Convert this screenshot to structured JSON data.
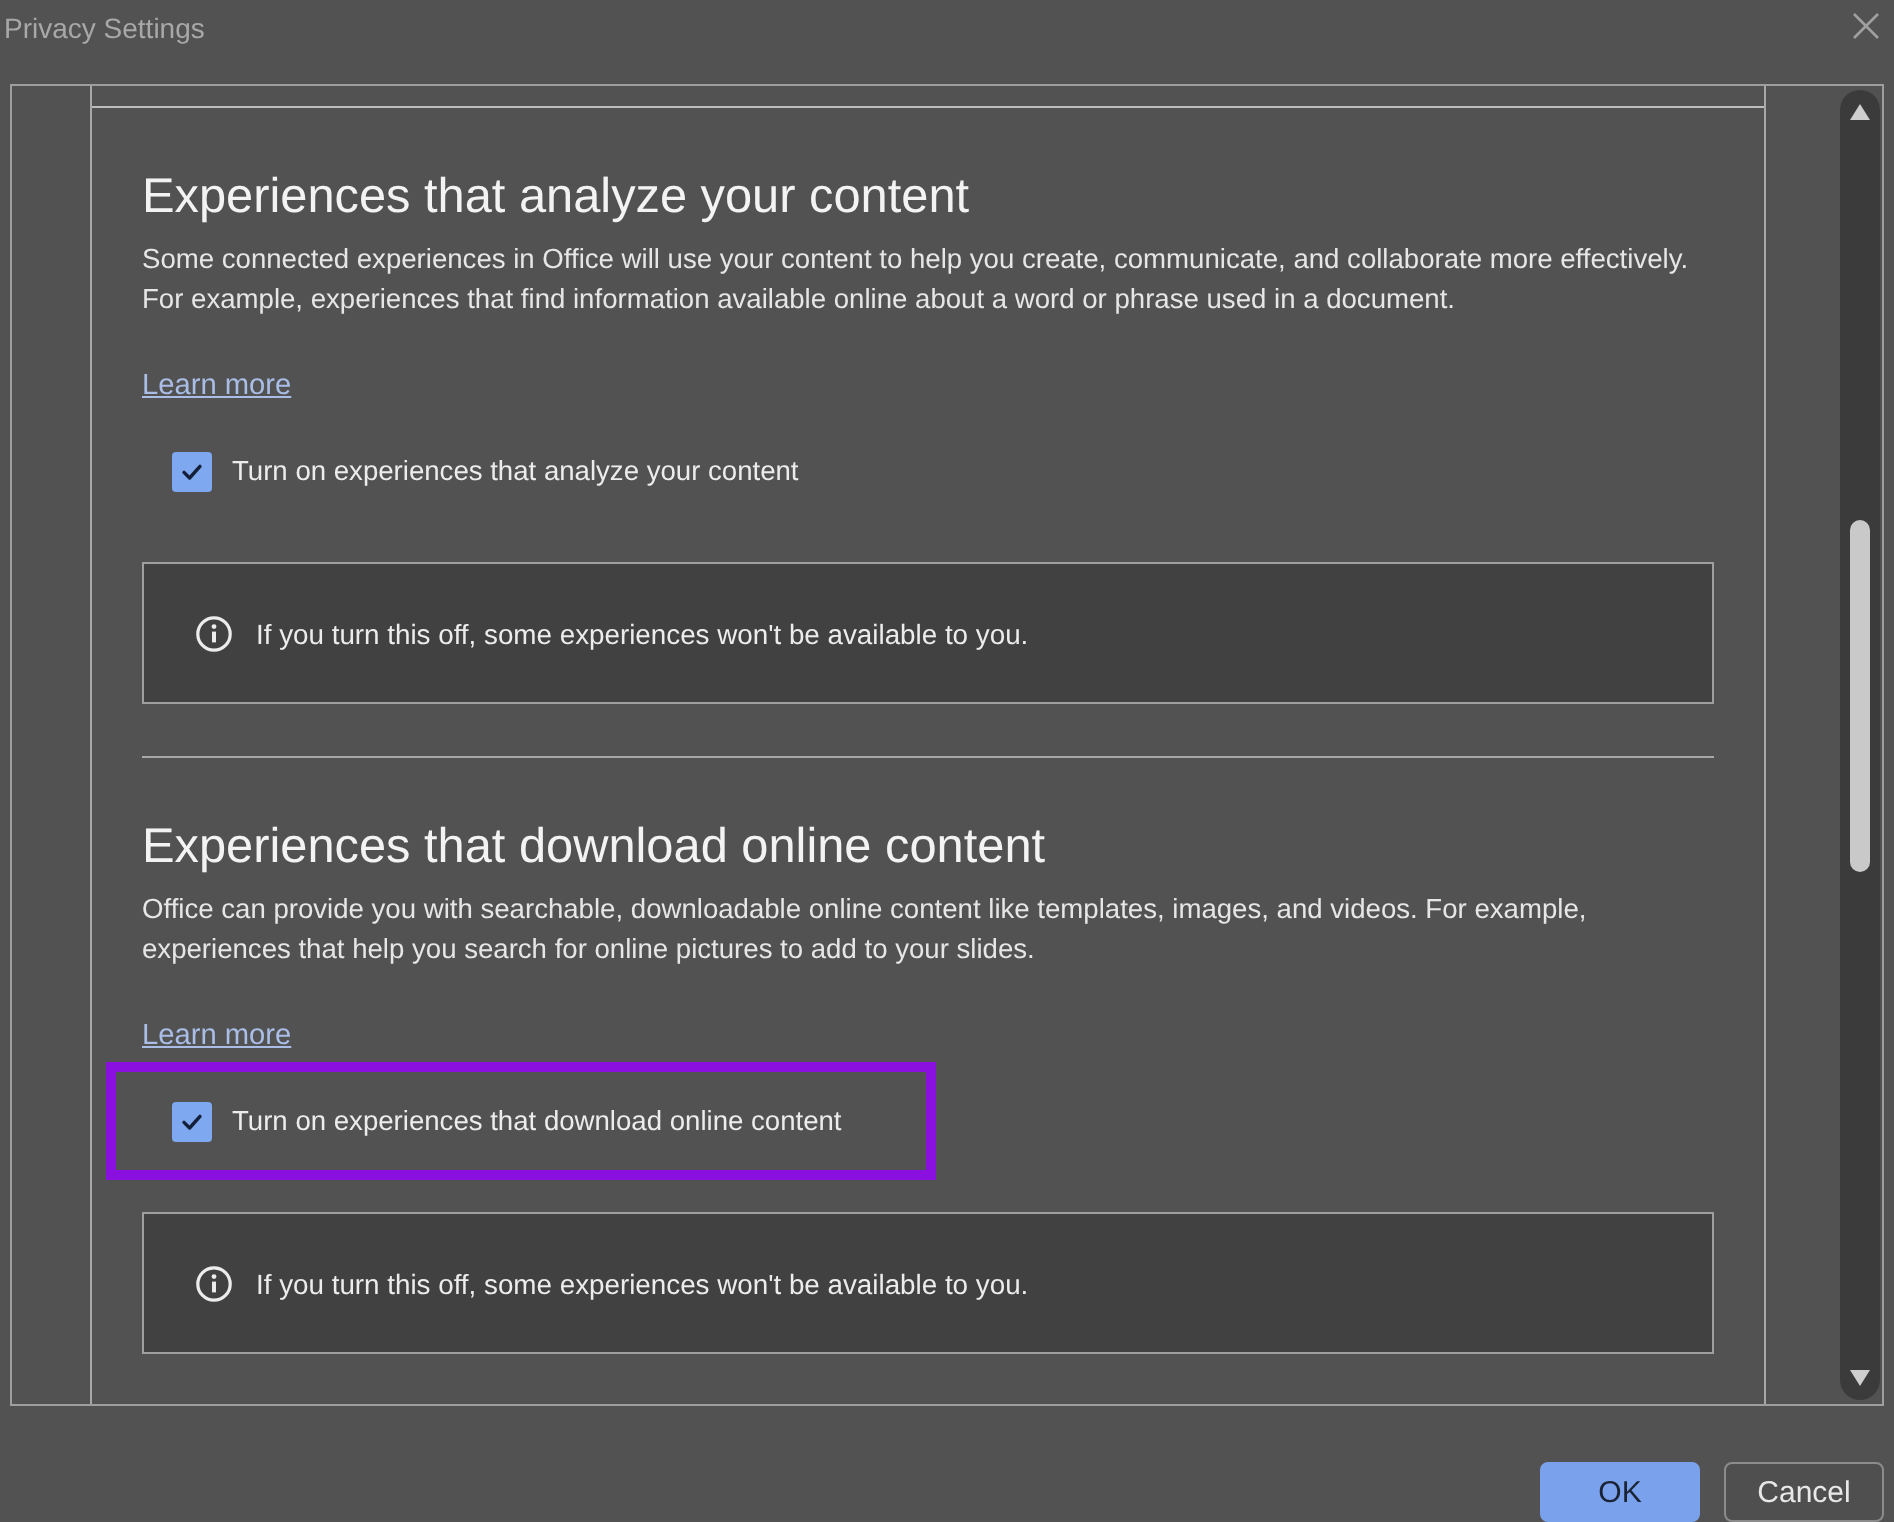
{
  "window": {
    "title": "Privacy Settings"
  },
  "sections": [
    {
      "heading": "Experiences that analyze your content",
      "description": "Some connected experiences in Office will use your content to help you create, communicate, and collaborate more effectively. For example, experiences that find information available online about a word or phrase used in a document.",
      "link": "Learn more",
      "checkbox": {
        "label": "Turn on experiences that analyze your content",
        "checked": true
      },
      "highlighted": false,
      "note": "If you turn this off, some experiences won't be available to you."
    },
    {
      "heading": "Experiences that download online content",
      "description": "Office can provide you with searchable, downloadable online content like templates, images, and videos. For example, experiences that help you search for online pictures to add to your slides.",
      "link": "Learn more",
      "checkbox": {
        "label": "Turn on experiences that download online content",
        "checked": true
      },
      "highlighted": true,
      "note": "If you turn this off, some experiences won't be available to you."
    }
  ],
  "buttons": [
    {
      "label": "OK",
      "kind": "primary"
    },
    {
      "label": "Cancel",
      "kind": "secondary"
    }
  ]
}
